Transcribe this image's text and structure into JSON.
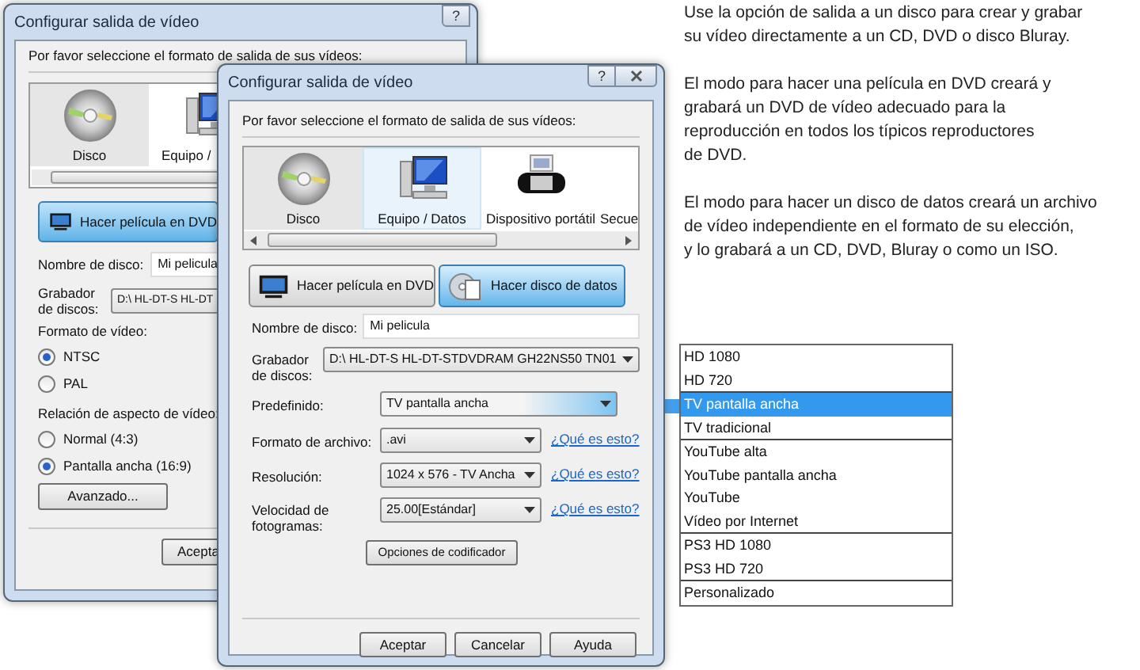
{
  "back_window": {
    "title": "Configurar salida de vídeo",
    "help_button": "?",
    "instruction": "Por favor seleccione el formato de salida de sus vídeos:",
    "formats": [
      {
        "label": "Disco",
        "selected": true
      },
      {
        "label": "Equipo /",
        "selected": false
      }
    ],
    "mode_button": {
      "label": "Hacer película en DVD",
      "selected": true
    },
    "disc_name": {
      "label": "Nombre de disco:",
      "value": "Mi pelicula"
    },
    "burner": {
      "label": "Grabador de discos:",
      "value": "D:\\ HL-DT-S HL-DT"
    },
    "video_format": {
      "label": "Formato de vídeo:",
      "options": [
        {
          "label": "NTSC",
          "checked": true
        },
        {
          "label": "PAL",
          "checked": false
        }
      ]
    },
    "aspect_ratio": {
      "label": "Relación de aspecto de vídeo:",
      "options": [
        {
          "label": "Normal (4:3)",
          "checked": false
        },
        {
          "label": "Pantalla ancha (16:9)",
          "checked": true
        }
      ]
    },
    "advanced_button": "Avanzado...",
    "ok_button": "Acepta"
  },
  "front_window": {
    "title": "Configurar salida de vídeo",
    "help_button": "?",
    "instruction": "Por favor seleccione el formato de salida de sus vídeos:",
    "formats": [
      {
        "kind": "disc",
        "label": "Disco",
        "selected": true,
        "hovered": false
      },
      {
        "kind": "computer",
        "label": "Equipo / Datos",
        "selected": false,
        "hovered": true
      },
      {
        "kind": "handheld",
        "label": "Dispositivo portátil",
        "selected": false,
        "hovered": false
      },
      {
        "kind": "cut",
        "label": "Secue",
        "selected": false,
        "hovered": false
      }
    ],
    "mode_buttons": [
      {
        "kind": "dvd",
        "label": "Hacer película en DVD",
        "selected": false
      },
      {
        "kind": "data",
        "label": "Hacer disco de datos",
        "selected": true
      }
    ],
    "fields": [
      {
        "kind": "text",
        "label": "Nombre de disco:",
        "value": "Mi pelicula"
      },
      {
        "kind": "combo",
        "label": "Grabador de discos:",
        "value": "D:\\ HL-DT-S HL-DT-STDVDRAM GH22NS50 TN01",
        "expanded": false
      },
      {
        "kind": "combo",
        "label": "Predefinido:",
        "value": "TV pantalla ancha",
        "expanded": true
      },
      {
        "kind": "combo",
        "label": "Formato de archivo:",
        "value": ".avi",
        "expanded": false,
        "link": "¿Qué es esto?"
      },
      {
        "kind": "combo",
        "label": "Resolución:",
        "value": "1024 x 576 - TV Ancha",
        "expanded": false,
        "link": "¿Qué es esto?"
      },
      {
        "kind": "combo",
        "label": "Velocidad de fotogramas:",
        "value": "25.00[Estándar]",
        "expanded": false,
        "link": "¿Qué es esto?"
      }
    ],
    "encoder_button": "Opciones de codificador",
    "buttons": [
      "Aceptar",
      "Cancelar",
      "Ayuda"
    ]
  },
  "description": {
    "paragraphs": [
      "Use la opción de salida a un disco para crear y grabar\nsu vídeo directamente a un CD, DVD o disco Bluray.",
      "El modo para hacer una película en DVD creará y\ngrabará un DVD de vídeo adecuado para la\nreproducción en todos los típicos reproductores\nde DVD.",
      "El modo para hacer un disco de datos creará un archivo\nde vídeo independiente en el formato de su elección,\ny lo grabará a un CD, DVD, Bluray o como un ISO."
    ]
  },
  "preset_list": {
    "groups": [
      [
        {
          "label": "HD 1080",
          "selected": false
        },
        {
          "label": "HD 720",
          "selected": false
        }
      ],
      [
        {
          "label": "TV pantalla ancha",
          "selected": true
        },
        {
          "label": "TV tradicional",
          "selected": false
        }
      ],
      [
        {
          "label": "YouTube alta",
          "selected": false
        },
        {
          "label": "YouTube pantalla ancha",
          "selected": false
        },
        {
          "label": "YouTube",
          "selected": false
        },
        {
          "label": "Vídeo por Internet",
          "selected": false
        }
      ],
      [
        {
          "label": "PS3 HD 1080",
          "selected": false
        },
        {
          "label": "PS3 HD 720",
          "selected": false
        }
      ],
      [
        {
          "label": "Personalizado",
          "selected": false
        }
      ]
    ]
  }
}
